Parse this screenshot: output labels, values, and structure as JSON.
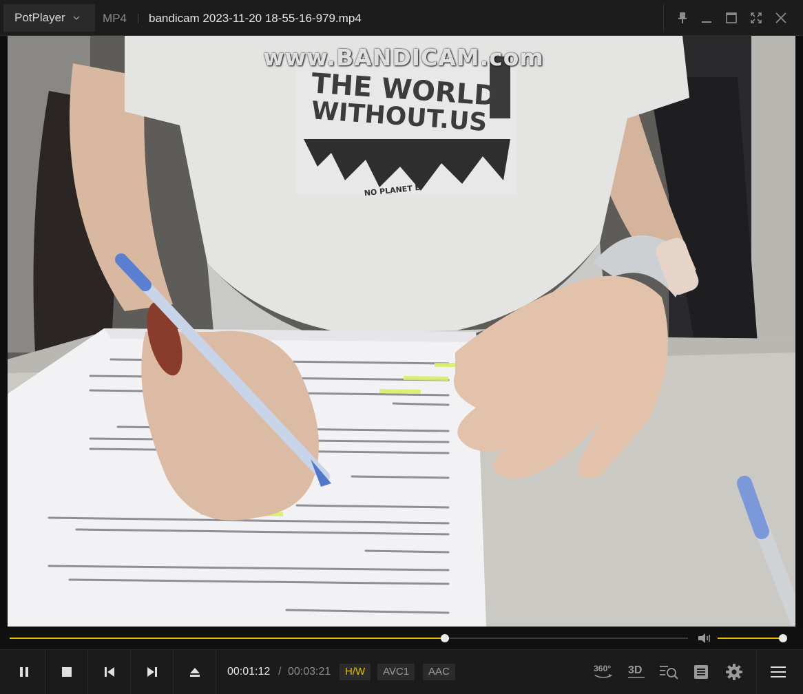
{
  "titlebar": {
    "app_name": "PotPlayer",
    "format": "MP4",
    "file_title": "bandicam 2023-11-20 18-55-16-979.mp4"
  },
  "video": {
    "watermark": "www.BANDICAM.com",
    "shirt_line1": "THE WORLD",
    "shirt_line2": "WITHOUT.US",
    "shirt_line3": "NO PLANET B"
  },
  "playback": {
    "progress_fraction": 0.642,
    "volume_fraction": 1.0,
    "accent_color": "#e6c000"
  },
  "controls": {
    "current_time": "00:01:12",
    "separator": "/",
    "duration": "00:03:21",
    "badge_hw": "H/W",
    "badge_video_codec": "AVC1",
    "badge_audio_codec": "AAC",
    "label_360": "360°",
    "label_3d": "3D"
  }
}
